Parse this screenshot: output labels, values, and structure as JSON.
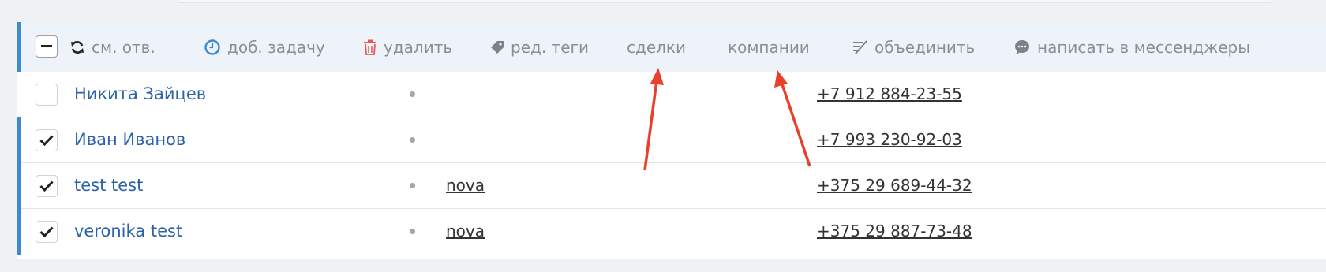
{
  "toolbar": {
    "select_all_state": "indeterminate",
    "actions": {
      "change_owner": "см. отв.",
      "add_task": "доб. задачу",
      "delete": "удалить",
      "edit_tags": "ред. теги",
      "deals": "сделки",
      "companies": "компании",
      "merge": "объединить",
      "messengers": "написать в мессенджеры"
    }
  },
  "rows": [
    {
      "name": "Никита Зайцев",
      "tag": "",
      "phone": "+7 912 884-23-55",
      "checked": false
    },
    {
      "name": "Иван Иванов",
      "tag": "",
      "phone": "+7 993 230-92-03",
      "checked": true
    },
    {
      "name": "test test",
      "tag": "nova",
      "phone": "+375 29 689-44-32",
      "checked": true
    },
    {
      "name": "veronika test",
      "tag": "nova",
      "phone": "+375 29 887-73-48",
      "checked": true
    }
  ],
  "colors": {
    "accent": "#3d8bcc",
    "link": "#2c62a7",
    "toolbar_bg": "#edf3f9",
    "delete_icon": "#e05a5a",
    "clock_icon": "#3d8bcc",
    "annotation_arrow": "#e8402a"
  }
}
